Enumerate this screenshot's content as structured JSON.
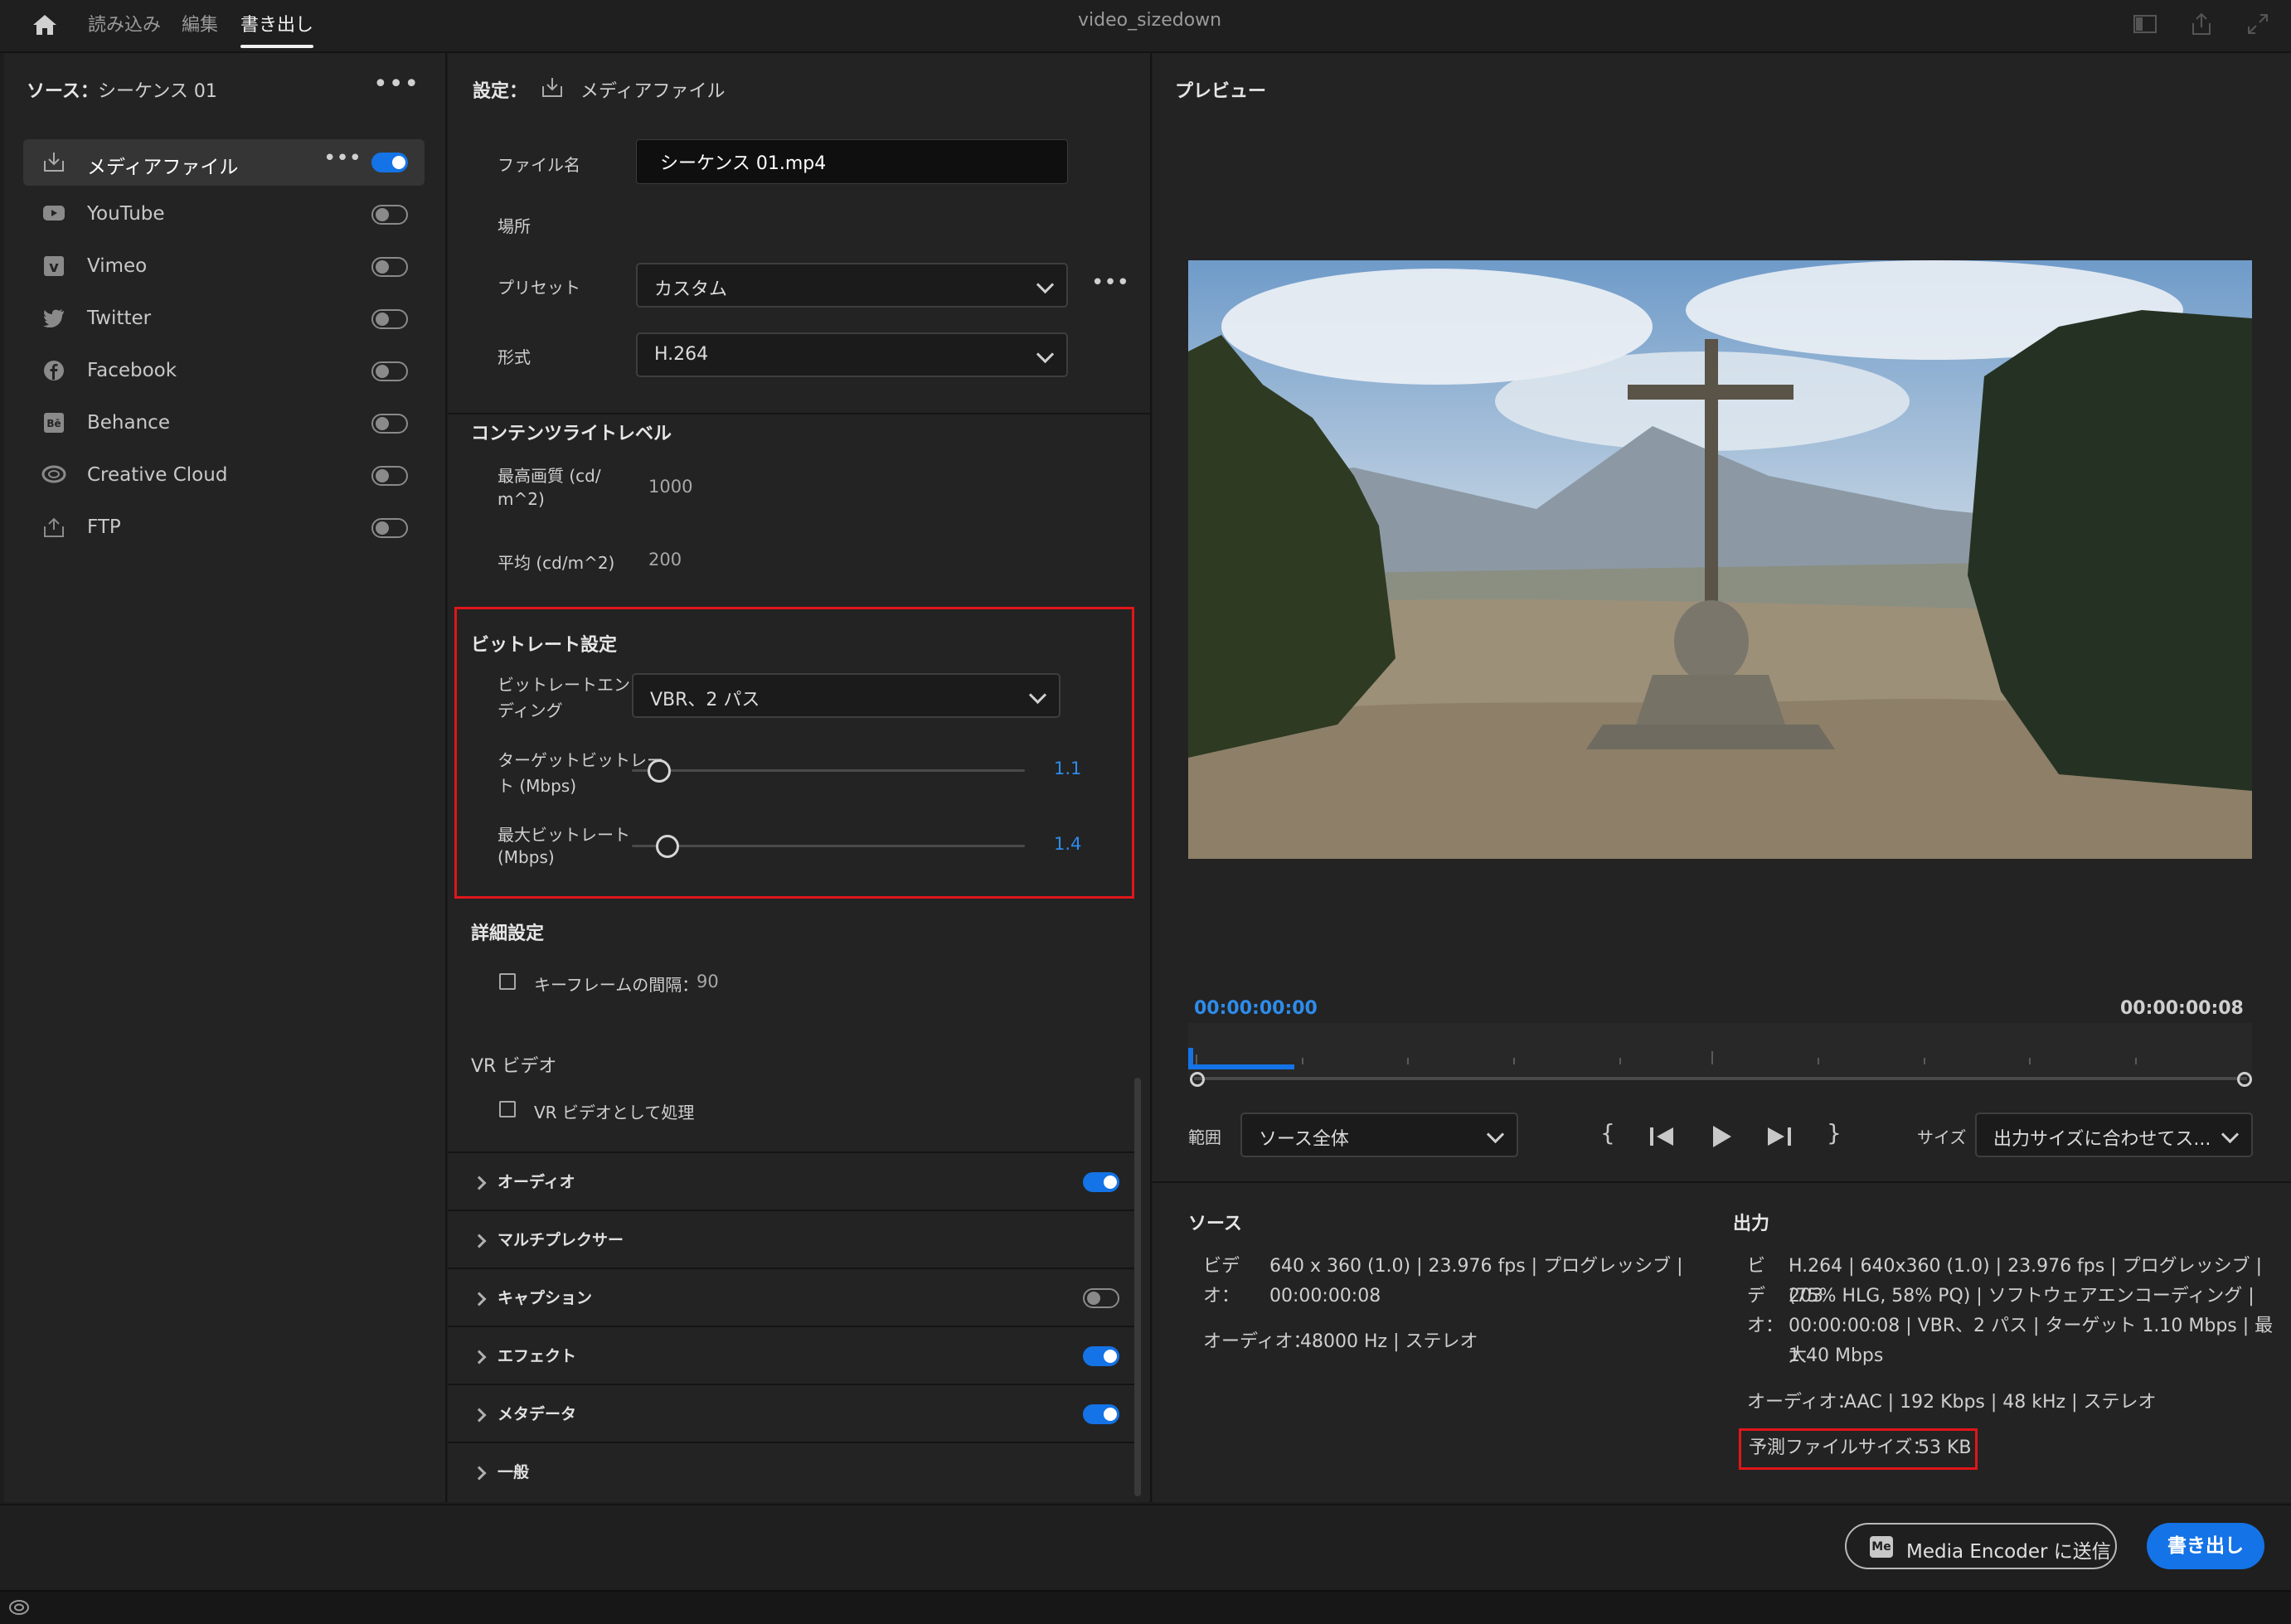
{
  "topbar": {
    "tabs": [
      "読み込み",
      "編集",
      "書き出し"
    ],
    "active_tab": "書き出し",
    "title": "video_sizedown"
  },
  "source": {
    "label": "ソース：",
    "sequence": "シーケンス 01"
  },
  "destinations": [
    {
      "label": "メディアファイル",
      "icon": "download-icon",
      "enabled": true
    },
    {
      "label": "YouTube",
      "icon": "youtube-icon",
      "enabled": false
    },
    {
      "label": "Vimeo",
      "icon": "vimeo-icon",
      "enabled": false
    },
    {
      "label": "Twitter",
      "icon": "twitter-icon",
      "enabled": false
    },
    {
      "label": "Facebook",
      "icon": "facebook-icon",
      "enabled": false
    },
    {
      "label": "Behance",
      "icon": "behance-icon",
      "enabled": false
    },
    {
      "label": "Creative Cloud",
      "icon": "creative-cloud-icon",
      "enabled": false
    },
    {
      "label": "FTP",
      "icon": "upload-icon",
      "enabled": false
    }
  ],
  "settings": {
    "header": "設定：",
    "target": "メディアファイル",
    "filename_label": "ファイル名",
    "filename_value": "シーケンス 01.mp4",
    "location_label": "場所",
    "preset_label": "プリセット",
    "preset_value": "カスタム",
    "format_label": "形式",
    "format_value": "H.264"
  },
  "content_light": {
    "title": "コンテンツライトレベル",
    "max_label_1": "最高画質 (cd/",
    "max_label_2": "m^2)",
    "max_value": "1000",
    "avg_label": "平均 (cd/m^2)",
    "avg_value": "200"
  },
  "bitrate": {
    "title": "ビットレート設定",
    "encoding_label_1": "ビットレートエンコー",
    "encoding_label_2": "ディング",
    "encoding_value": "VBR、2 パス",
    "target_label_1": "ターゲットビットレー",
    "target_label_2": "ト (Mbps)",
    "target_value": "1.1",
    "max_label_1": "最大ビットレート",
    "max_label_2": "(Mbps)",
    "max_value": "1.4"
  },
  "advanced": {
    "title": "詳細設定",
    "keyframe_label": "キーフレームの間隔：",
    "keyframe_value": "90"
  },
  "vr": {
    "title": "VR ビデオ",
    "process_label": "VR ビデオとして処理"
  },
  "sections": [
    {
      "label": "オーディオ",
      "toggle": true
    },
    {
      "label": "マルチプレクサー",
      "toggle": null
    },
    {
      "label": "キャプション",
      "toggle": false
    },
    {
      "label": "エフェクト",
      "toggle": true
    },
    {
      "label": "メタデータ",
      "toggle": true
    },
    {
      "label": "一般",
      "toggle": null
    }
  ],
  "preview": {
    "title": "プレビュー",
    "timecode_start": "00:00:00:00",
    "timecode_end": "00:00:00:08",
    "range_label": "範囲",
    "range_value": "ソース全体",
    "size_label": "サイズ",
    "size_value": "出力サイズに合わせてス..."
  },
  "source_info": {
    "title": "ソース",
    "video_label_1": "ビデ",
    "video_label_2": "オ：",
    "video_line_1": "640 x 360 (1.0) | 23.976 fps | プログレッシブ |",
    "video_line_2": "00:00:00:08",
    "audio_label": "オーディオ：",
    "audio_value": "48000 Hz | ステレオ"
  },
  "output_info": {
    "title": "出力",
    "video_label_1": "ビ",
    "video_label_2": "デ",
    "video_label_3": "オ：",
    "video_line_1": "H.264 | 640x360 (1.0) | 23.976 fps | プログレッシブ | 203",
    "video_line_2": "(75% HLG, 58% PQ) | ソフトウェアエンコーディング |",
    "video_line_3": "00:00:00:08 | VBR、2 パス | ターゲット 1.10 Mbps | 最大",
    "video_line_4": "1.40 Mbps",
    "audio_label": "オーディオ：",
    "audio_value": "AAC | 192 Kbps | 48 kHz | ステレオ",
    "estimate_label": "予測ファイルサイズ：",
    "estimate_value": "53 KB"
  },
  "buttons": {
    "media_encoder_badge": "Me",
    "media_encoder": "Media Encoder に送信",
    "export": "書き出し"
  },
  "colors": {
    "accent": "#1473e6",
    "highlight": "#e0161b",
    "timecode": "#2d8ceb"
  }
}
